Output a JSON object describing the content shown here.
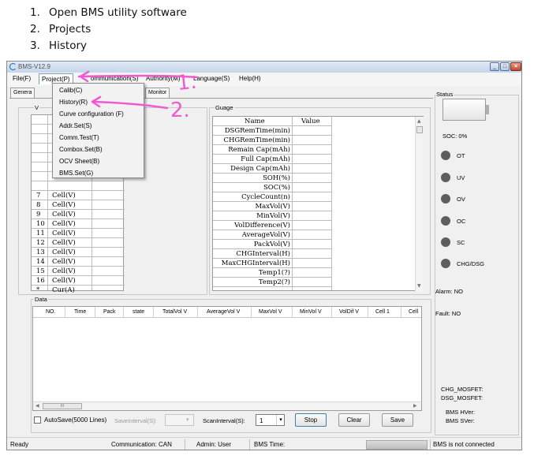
{
  "steps": [
    {
      "num": "1.",
      "text": "Open BMS utility software"
    },
    {
      "num": "2.",
      "text": "Projects"
    },
    {
      "num": "3.",
      "text": "History"
    }
  ],
  "window": {
    "title": "BMS-V12.9"
  },
  "menu": [
    "File(F)",
    "Project(P)",
    "ommunication(S)",
    "Authority(M)",
    "Language(S)",
    "Help(H)"
  ],
  "tabs": [
    "Genera",
    "Monitor"
  ],
  "project_menu": [
    "Calib(C)",
    "History(R)",
    "Curve configuration (F)",
    "Addr.Set(S)",
    "Comm.Test(T)",
    "Combox.Set(B)",
    "OCV Sheet(B)",
    "BMS.Set(G)"
  ],
  "cells_panel": {
    "title_fragment": "V",
    "rows": [
      {
        "idx": "7",
        "name": "Cell(V)"
      },
      {
        "idx": "8",
        "name": "Cell(V)"
      },
      {
        "idx": "9",
        "name": "Cell(V)"
      },
      {
        "idx": "10",
        "name": "Cell(V)"
      },
      {
        "idx": "11",
        "name": "Cell(V)"
      },
      {
        "idx": "12",
        "name": "Cell(V)"
      },
      {
        "idx": "13",
        "name": "Cell(V)"
      },
      {
        "idx": "14",
        "name": "Cell(V)"
      },
      {
        "idx": "15",
        "name": "Cell(V)"
      },
      {
        "idx": "16",
        "name": "Cell(V)"
      },
      {
        "idx": "*",
        "name": "Cur(A)"
      }
    ]
  },
  "gauge": {
    "title": "Guage",
    "headers": [
      "Name",
      "Value"
    ],
    "rows": [
      "DSGRemTime(min)",
      "CHGRemTime(min)",
      "Remain Cap(mAh)",
      "Full Cap(mAh)",
      "Design Cap(mAh)",
      "SOH(%)",
      "SOC(%)",
      "CycleCount(n)",
      "MaxVol(V)",
      "MinVol(V)",
      "VolDifference(V)",
      "AverageVol(V)",
      "PackVol(V)",
      "CHGInterval(H)",
      "MaxCHGInterval(H)",
      "Temp1(?)",
      "Temp2(?)"
    ]
  },
  "data_panel": {
    "title": "Data",
    "columns": [
      "NO.",
      "Time",
      "Pack",
      "state",
      "TotalVol V",
      "AverageVol V",
      "MaxVol V",
      "MinVol V",
      "VolDif V",
      "Cell 1",
      "Cell"
    ]
  },
  "controls": {
    "autosave": "AutoSave(5000 Lines)",
    "save_interval": "SaveInterval(S):",
    "scan_interval": "ScanInterval(S):",
    "scan_value": "1",
    "stop": "Stop",
    "clear": "Clear",
    "save": "Save"
  },
  "status": {
    "title": "Status",
    "soc": "SOC: 0%",
    "indicators": [
      "OT",
      "UV",
      "OV",
      "OC",
      "SC",
      "CHG/DSG"
    ],
    "alarm": "Alarm: NO",
    "fault": "Fault: NO",
    "chg_mosfet": "CHG_MOSFET:",
    "dsg_mosfet": "DSG_MOSFET:",
    "bms_hver": "BMS HVer:",
    "bms_sver": "BMS SVer:"
  },
  "statusbar": {
    "ready": "Ready",
    "communication": "Communication: CAN",
    "admin": "Admin: User",
    "bms_time": "BMS Time:",
    "connection": "BMS is not connected"
  },
  "annotations": {
    "one": "1.",
    "two": "2.",
    "color": "#f05ad0"
  },
  "colors": {
    "led": "#5e5e5e",
    "accent": "#3c7fb1",
    "annotation": "#f05ad0"
  }
}
